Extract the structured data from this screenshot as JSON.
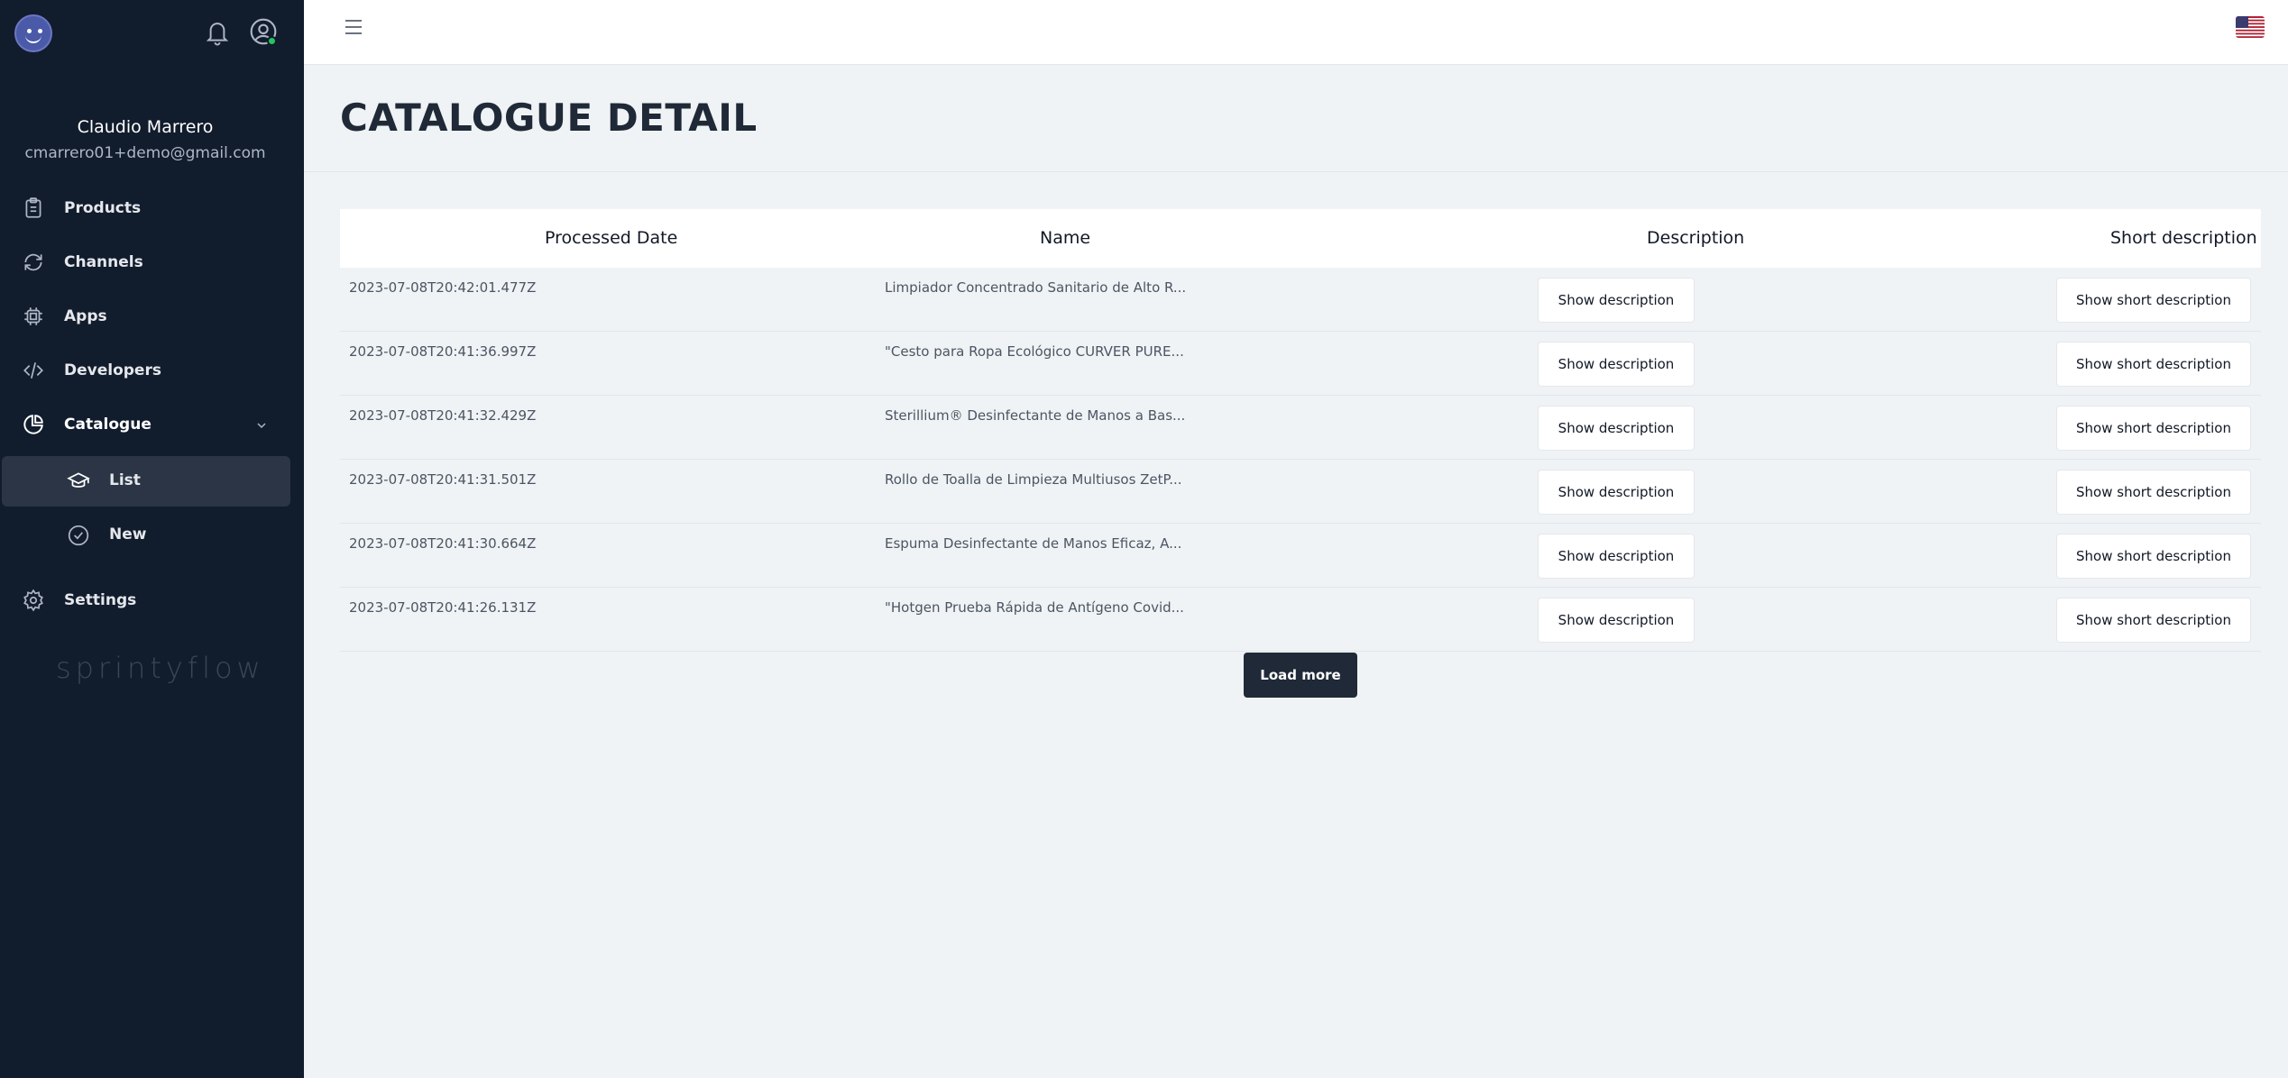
{
  "user": {
    "name": "Claudio Marrero",
    "email": "cmarrero01+demo@gmail.com"
  },
  "sidebar": {
    "items": [
      {
        "label": "Products",
        "icon": "clipboard-icon"
      },
      {
        "label": "Channels",
        "icon": "refresh-icon"
      },
      {
        "label": "Apps",
        "icon": "chip-icon"
      },
      {
        "label": "Developers",
        "icon": "code-icon"
      },
      {
        "label": "Catalogue",
        "icon": "pie-chart-icon"
      }
    ],
    "sub_items": [
      {
        "label": "List",
        "icon": "graduation-cap-icon",
        "active": true
      },
      {
        "label": "New",
        "icon": "check-circle-icon",
        "active": false
      }
    ],
    "settings_label": "Settings",
    "brand": "sprintyflow"
  },
  "header": {
    "title": "CATALOGUE DETAIL"
  },
  "table": {
    "columns": [
      "Processed Date",
      "Name",
      "Description",
      "Short description"
    ],
    "rows": [
      {
        "date": "2023-07-08T20:42:01.477Z",
        "name": "Limpiador Concentrado Sanitario de Alto R...",
        "desc_btn": "Show description",
        "short_btn": "Show short description"
      },
      {
        "date": "2023-07-08T20:41:36.997Z",
        "name": "\"Cesto para Ropa Ecológico CURVER PURE...",
        "desc_btn": "Show description",
        "short_btn": "Show short description"
      },
      {
        "date": "2023-07-08T20:41:32.429Z",
        "name": "Sterillium® Desinfectante de Manos a Bas...",
        "desc_btn": "Show description",
        "short_btn": "Show short description"
      },
      {
        "date": "2023-07-08T20:41:31.501Z",
        "name": "Rollo de Toalla de Limpieza Multiusos ZetP...",
        "desc_btn": "Show description",
        "short_btn": "Show short description"
      },
      {
        "date": "2023-07-08T20:41:30.664Z",
        "name": "Espuma Desinfectante de Manos Eficaz, A...",
        "desc_btn": "Show description",
        "short_btn": "Show short description"
      },
      {
        "date": "2023-07-08T20:41:26.131Z",
        "name": "\"Hotgen Prueba Rápida de Antígeno Covid...",
        "desc_btn": "Show description",
        "short_btn": "Show short description"
      }
    ]
  },
  "load_more_label": "Load more",
  "colors": {
    "sidebar_bg": "#111c2d",
    "active_item_bg": "#2b3546",
    "page_bg": "#eff3f5",
    "primary_button": "#1f2937",
    "online_status": "#22c55e"
  }
}
